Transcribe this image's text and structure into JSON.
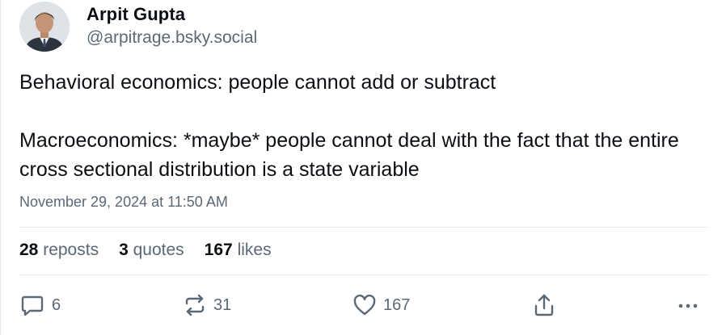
{
  "author": {
    "name": "Arpit Gupta",
    "handle": "@arpitrage.bsky.social"
  },
  "post": {
    "line1": "Behavioral economics: people cannot add or subtract",
    "line2": "Macroeconomics: *maybe* people cannot deal with the fact that the entire cross sectional distribution is a state variable",
    "timestamp": "November 29, 2024 at 11:50 AM"
  },
  "stats": {
    "reposts_count": "28",
    "reposts_label": "reposts",
    "quotes_count": "3",
    "quotes_label": "quotes",
    "likes_count": "167",
    "likes_label": "likes"
  },
  "actions": {
    "reply_count": "6",
    "repost_count": "31",
    "like_count": "167"
  },
  "icons": {
    "reply": "speech-bubble-icon",
    "repost": "repost-arrows-icon",
    "like": "heart-icon",
    "share": "share-icon",
    "more": "ellipsis-icon"
  },
  "colors": {
    "text": "#0b0f14",
    "muted": "#5b6876",
    "divider": "#e6e9ee"
  }
}
